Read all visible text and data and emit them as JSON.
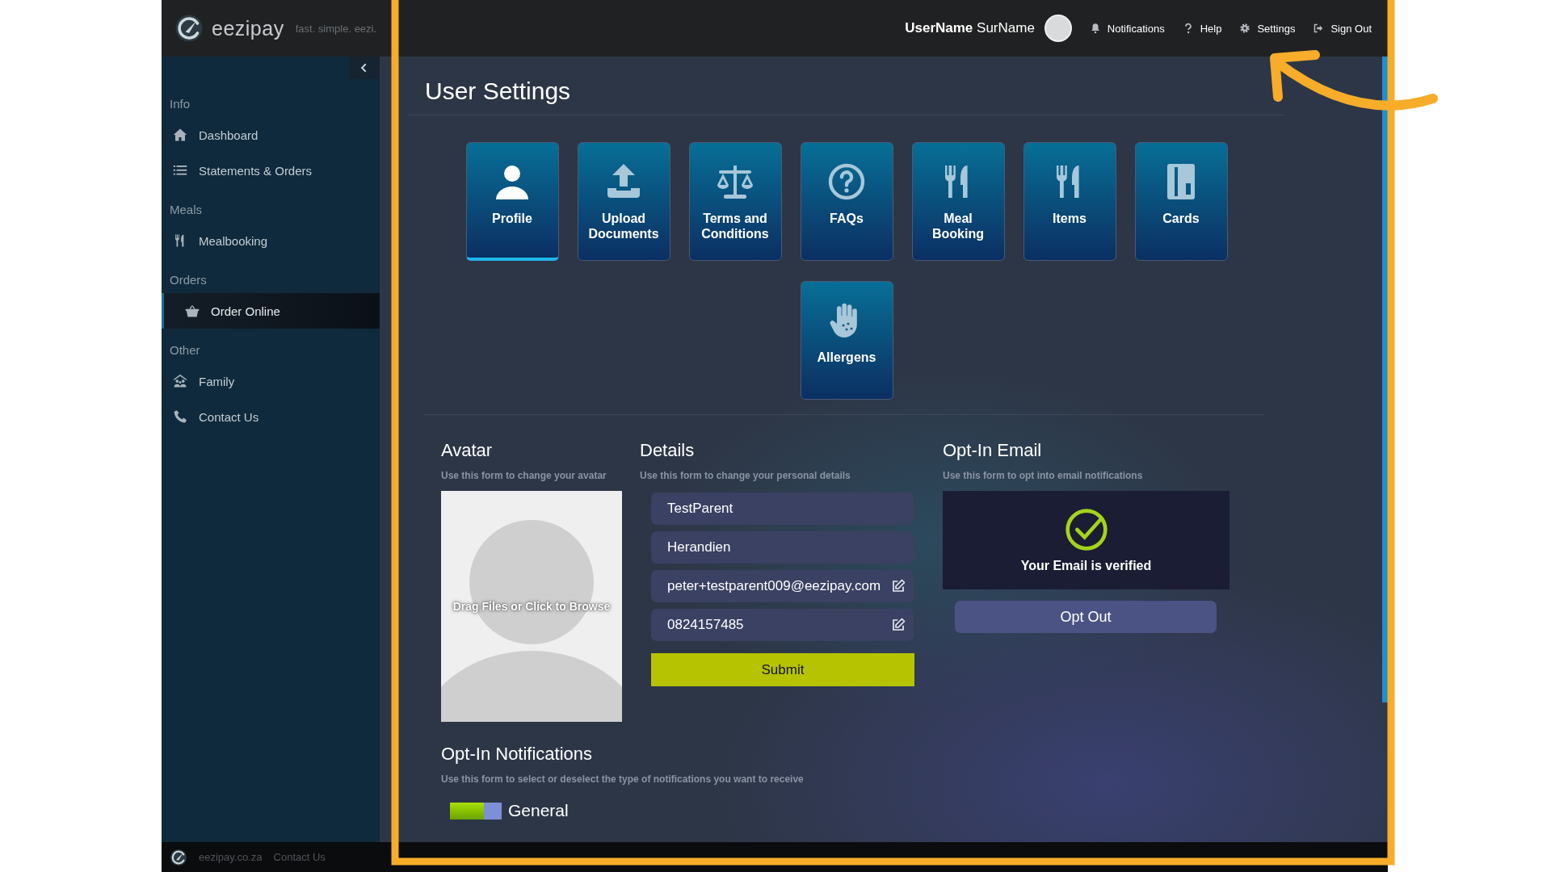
{
  "header": {
    "logo": "eezipay",
    "tagline": "fast. simple. eezi.",
    "user": "**UserName** SurName",
    "links": [
      {
        "kind": "notifications",
        "label": "Notifications"
      },
      {
        "kind": "help",
        "label": "Help"
      },
      {
        "kind": "settings",
        "label": "Settings"
      },
      {
        "kind": "signout",
        "label": "Sign Out"
      }
    ]
  },
  "sidebar": {
    "groups": [
      {
        "label": "Info",
        "items": [
          {
            "kind": "dashboard",
            "label": "Dashboard",
            "selected": false
          },
          {
            "kind": "statements",
            "label": "Statements & Orders",
            "selected": false
          }
        ]
      },
      {
        "label": "Meals",
        "items": [
          {
            "kind": "meals",
            "label": "Mealbooking",
            "selected": false
          }
        ]
      },
      {
        "label": "Orders",
        "items": [
          {
            "kind": "basket",
            "label": "Order Online",
            "selected": true
          }
        ]
      },
      {
        "label": "Other",
        "items": [
          {
            "kind": "family",
            "label": "Family",
            "selected": false
          },
          {
            "kind": "contact",
            "label": "Contact Us",
            "selected": false
          }
        ]
      }
    ]
  },
  "page": {
    "title": "User Settings"
  },
  "tiles": [
    {
      "kind": "profile",
      "label": "Profile",
      "selected": true
    },
    {
      "kind": "upload",
      "label": "Upload Documents",
      "selected": false
    },
    {
      "kind": "terms",
      "label": "Terms and Conditions",
      "selected": false
    },
    {
      "kind": "faqs",
      "label": "FAQs",
      "selected": false
    },
    {
      "kind": "meals",
      "label": "Meal Booking",
      "selected": false
    },
    {
      "kind": "meals",
      "label": "Items",
      "selected": false
    },
    {
      "kind": "cards",
      "label": "Cards",
      "selected": false
    },
    {
      "kind": "allergens",
      "label": "Allergens",
      "selected": false
    }
  ],
  "avatar": {
    "title": "Avatar",
    "description": "Use this form to change your avatar",
    "dropzone": "Drag Files or Click to Browse"
  },
  "details": {
    "title": "Details",
    "description": "Use this form to change your personal details",
    "fields": [
      {
        "value": "TestParent",
        "editable": false
      },
      {
        "value": "Herandien",
        "editable": false
      },
      {
        "value": "peter+testparent009@eezipay.com",
        "editable": true
      },
      {
        "value": "0824157485",
        "editable": true
      }
    ],
    "submit": "Submit"
  },
  "opt_in_email": {
    "title": "Opt-In Email",
    "description": "Use this form to opt into email notifications",
    "status": "Your Email is verified",
    "button": "Opt Out"
  },
  "opt_in_notifications": {
    "title": "Opt-In Notifications",
    "description": "Use this form to select or deselect the type of notifications you want to receive",
    "toggles": [
      {
        "label": "General",
        "on": true
      }
    ]
  },
  "footer": {
    "links": [
      "eezipay.co.za",
      "Contact Us"
    ]
  }
}
